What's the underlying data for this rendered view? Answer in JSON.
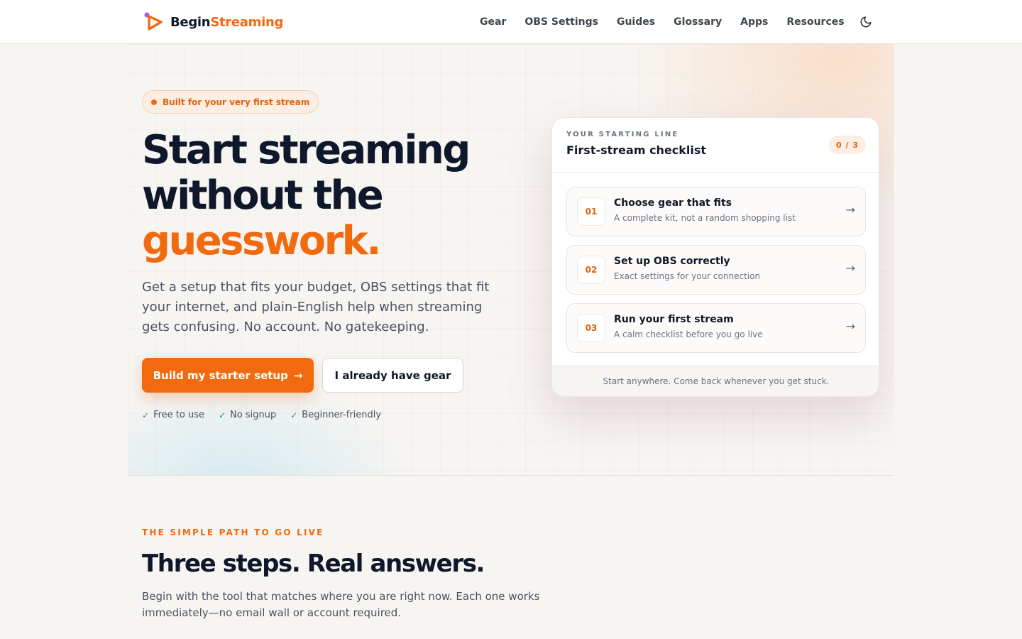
{
  "brand": {
    "name_part1": "Begin",
    "name_part2": "Streaming",
    "accent": "#f26a0f",
    "dark": "#0f172a"
  },
  "nav": {
    "items": [
      {
        "label": "Gear"
      },
      {
        "label": "OBS Settings"
      },
      {
        "label": "Guides"
      },
      {
        "label": "Glossary"
      },
      {
        "label": "Apps"
      },
      {
        "label": "Resources"
      }
    ],
    "theme_toggle_icon": "moon-icon"
  },
  "hero": {
    "badge": "Built for your very first stream",
    "title_line1": "Start streaming",
    "title_line2": "without the",
    "title_highlight": "guesswork.",
    "subtitle": "Get a setup that fits your budget, OBS settings that fit your internet, and plain-English help when streaming gets confusing. No account. No gatekeeping.",
    "primary_cta": "Build my starter setup",
    "primary_cta_icon": "arrow-right-icon",
    "secondary_cta": "I already have gear",
    "perks": [
      "Free to use",
      "No signup",
      "Beginner-friendly"
    ],
    "perk_icon": "check-icon"
  },
  "checklist": {
    "eyebrow": "YOUR STARTING LINE",
    "title": "First-stream checklist",
    "progress": "0 / 3",
    "steps": [
      {
        "num": "01",
        "title": "Choose gear that fits",
        "desc": "A complete kit, not a random shopping list"
      },
      {
        "num": "02",
        "title": "Set up OBS correctly",
        "desc": "Exact settings for your connection"
      },
      {
        "num": "03",
        "title": "Run your first stream",
        "desc": "A calm checklist before you go live"
      }
    ],
    "footer": "Start anywhere. Come back whenever you get stuck."
  },
  "path_section": {
    "eyebrow": "THE SIMPLE PATH TO GO LIVE",
    "title": "Three steps. Real answers.",
    "subtitle": "Begin with the tool that matches where you are right now. Each one works immediately—no email wall or account required."
  }
}
